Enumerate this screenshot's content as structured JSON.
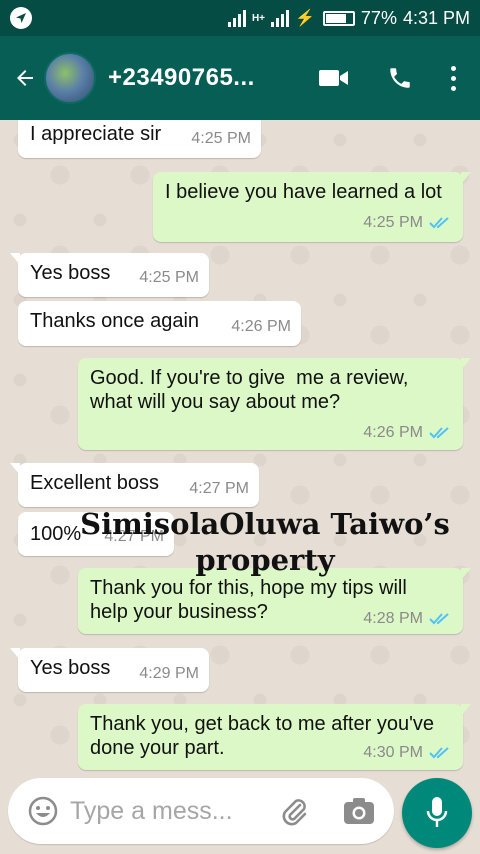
{
  "status_bar": {
    "network_type": "H+",
    "battery_percent": "77%",
    "battery_level": 0.77,
    "time": "4:31 PM"
  },
  "header": {
    "contact_name": "+23490765...",
    "back_icon": "arrow-left-icon",
    "video_icon": "video-camera-icon",
    "call_icon": "phone-icon",
    "menu_icon": "more-vert-icon"
  },
  "messages": [
    {
      "direction": "in",
      "text": "I appreciate sir",
      "time": "4:25 PM"
    },
    {
      "direction": "out",
      "text": "I believe you have learned a lot",
      "time": "4:25 PM",
      "read": true
    },
    {
      "direction": "in",
      "text": "Yes boss",
      "time": "4:25 PM"
    },
    {
      "direction": "in",
      "text": "Thanks once again",
      "time": "4:26 PM"
    },
    {
      "direction": "out",
      "text": "Good. If you're to give  me a review,\nwhat will you say about me?",
      "time": "4:26 PM",
      "read": true
    },
    {
      "direction": "in",
      "text": "Excellent boss",
      "time": "4:27 PM"
    },
    {
      "direction": "in",
      "text": "100%",
      "time": "4:27 PM"
    },
    {
      "direction": "out",
      "text": "Thank you for this, hope my tips will\nhelp your business?",
      "time": "4:28 PM",
      "read": true
    },
    {
      "direction": "in",
      "text": "Yes boss",
      "time": "4:29 PM"
    },
    {
      "direction": "out",
      "text": "Thank you, get back to me after you've\ndone your part.",
      "time": "4:30 PM",
      "read": true
    }
  ],
  "watermark": {
    "line1": "SimisolaOluwa Taiwo’s",
    "line2": "property"
  },
  "composer": {
    "placeholder": "Type a mess...",
    "emoji_icon": "emoji-icon",
    "attach_icon": "paperclip-icon",
    "camera_icon": "camera-icon",
    "mic_icon": "microphone-icon"
  },
  "colors": {
    "header": "#075e54",
    "status_bar": "#054d44",
    "incoming_bubble": "#ffffff",
    "outgoing_bubble": "#dcf8c6",
    "read_ticks": "#4fc3f7",
    "mic_button": "#00897b"
  }
}
